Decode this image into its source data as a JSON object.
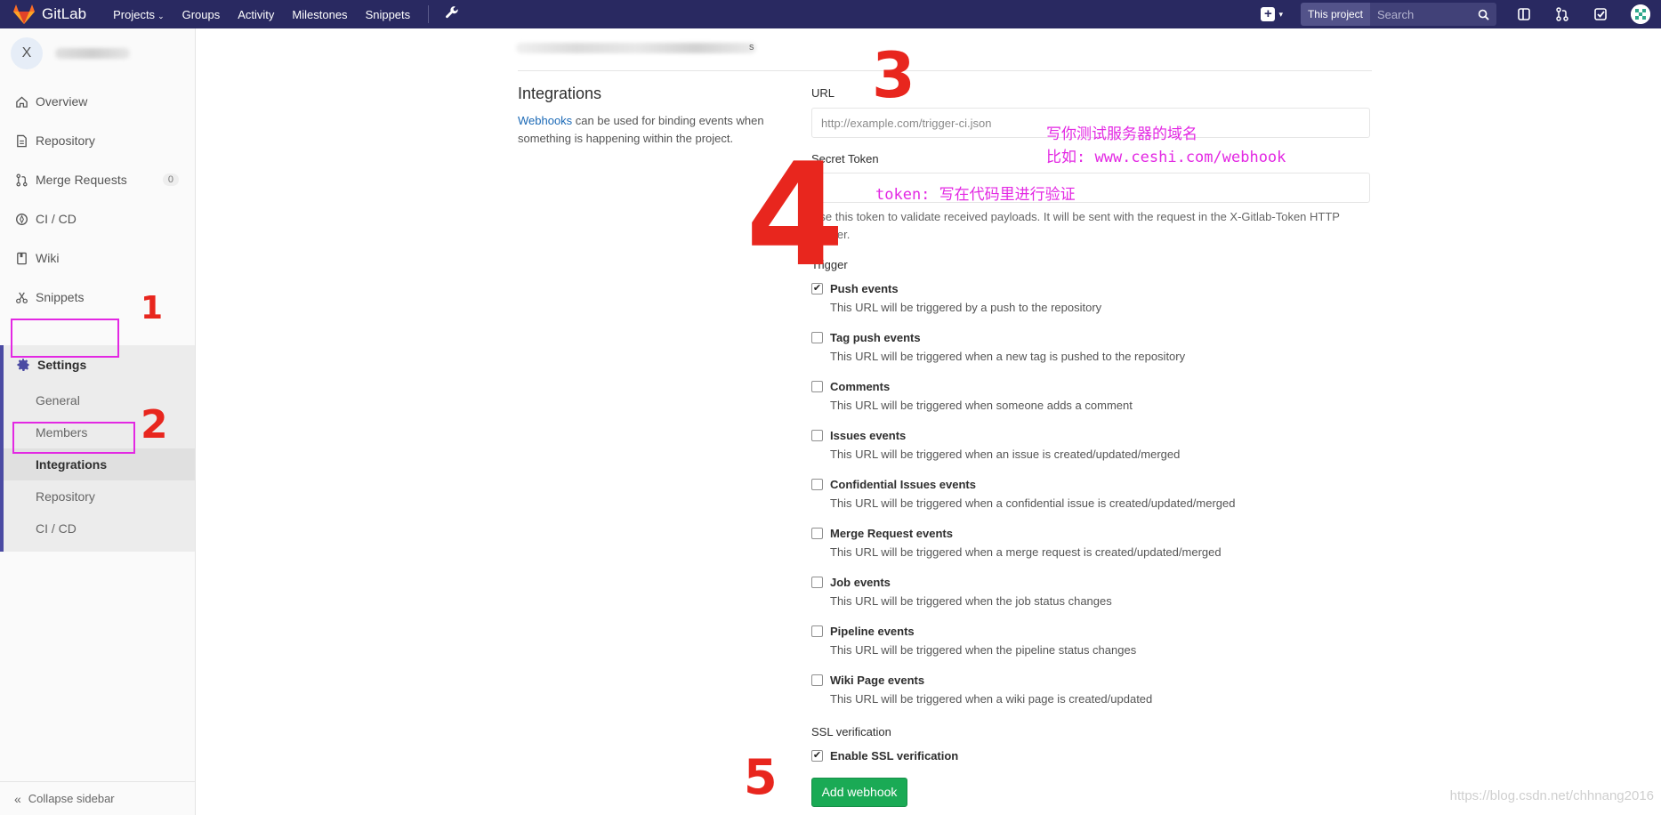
{
  "navbar": {
    "brand": "GitLab",
    "items": [
      {
        "label": "Projects",
        "caret": "⌄"
      },
      {
        "label": "Groups"
      },
      {
        "label": "Activity"
      },
      {
        "label": "Milestones"
      },
      {
        "label": "Snippets"
      }
    ],
    "scope": "This project",
    "search_placeholder": "Search",
    "bg_color": "#292961"
  },
  "sidebar": {
    "project_initial": "X",
    "items": [
      {
        "label": "Overview",
        "icon": "home-icon"
      },
      {
        "label": "Repository",
        "icon": "doc-icon"
      },
      {
        "label": "Merge Requests",
        "icon": "merge-icon",
        "count": "0"
      },
      {
        "label": "CI / CD",
        "icon": "rocket-icon"
      },
      {
        "label": "Wiki",
        "icon": "book-icon"
      },
      {
        "label": "Snippets",
        "icon": "scissors-icon"
      }
    ],
    "settings": {
      "label": "Settings",
      "sub_items": [
        "General",
        "Members",
        "Integrations",
        "Repository",
        "CI / CD"
      ],
      "active": "Integrations"
    },
    "collapse": "Collapse sidebar"
  },
  "breadcrumb_tail": "s",
  "section": {
    "title": "Integrations",
    "desc_link": "Webhooks",
    "desc_text": " can be used for binding events when something is happening within the project."
  },
  "form": {
    "url_label": "URL",
    "url_placeholder": "http://example.com/trigger-ci.json",
    "token_label": "Secret Token",
    "token_help": "Use this token to validate received payloads. It will be sent with the request in the X-Gitlab-Token HTTP header.",
    "trigger_label": "Trigger",
    "triggers": [
      {
        "name": "Push events",
        "desc": "This URL will be triggered by a push to the repository",
        "checked": true
      },
      {
        "name": "Tag push events",
        "desc": "This URL will be triggered when a new tag is pushed to the repository",
        "checked": false
      },
      {
        "name": "Comments",
        "desc": "This URL will be triggered when someone adds a comment",
        "checked": false
      },
      {
        "name": "Issues events",
        "desc": "This URL will be triggered when an issue is created/updated/merged",
        "checked": false
      },
      {
        "name": "Confidential Issues events",
        "desc": "This URL will be triggered when a confidential issue is created/updated/merged",
        "checked": false
      },
      {
        "name": "Merge Request events",
        "desc": "This URL will be triggered when a merge request is created/updated/merged",
        "checked": false
      },
      {
        "name": "Job events",
        "desc": "This URL will be triggered when the job status changes",
        "checked": false
      },
      {
        "name": "Pipeline events",
        "desc": "This URL will be triggered when the pipeline status changes",
        "checked": false
      },
      {
        "name": "Wiki Page events",
        "desc": "This URL will be triggered when a wiki page is created/updated",
        "checked": false
      }
    ],
    "ssl_label": "SSL verification",
    "ssl_checkbox": "Enable SSL verification",
    "ssl_checked": true,
    "submit": "Add webhook"
  },
  "annotations": {
    "url_note_line1": "写你测试服务器的域名",
    "url_note_line2": "比如: www.ceshi.com/webhook",
    "token_note": "token: 写在代码里进行验证",
    "numbers": [
      "1",
      "2",
      "3",
      "4",
      "5"
    ],
    "color": "#e328e3"
  },
  "watermark": "https://blog.csdn.net/chhnang2016"
}
